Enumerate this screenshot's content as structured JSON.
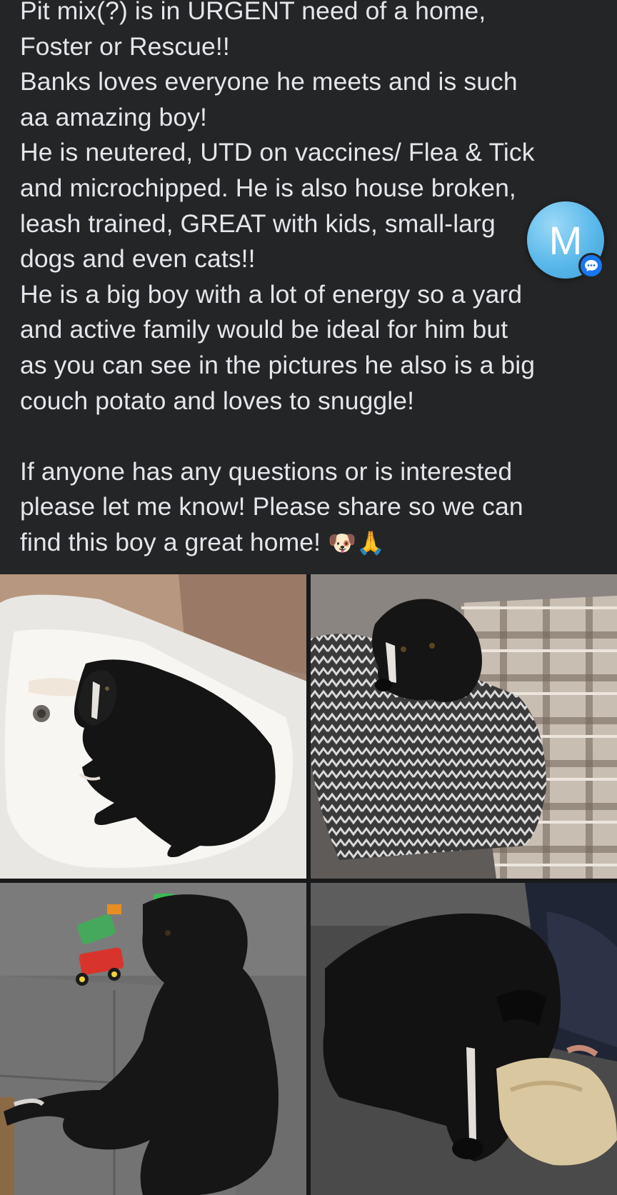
{
  "post": {
    "lines": [
      "Pit mix(?) is in URGENT need of a home,",
      "Foster or Rescue!!",
      "Banks loves everyone he meets and is such",
      "aa amazing boy!",
      "He is neutered, UTD on vaccines/ Flea & Tick",
      "and microchipped. He is also house broken,",
      "leash trained, GREAT with kids, small-larg",
      "dogs and even cats!!",
      "He is a big boy with a lot of energy so a yard",
      "and active family would be ideal for him but",
      "as you can see in the pictures he also is a big",
      "couch potato and loves to snuggle!",
      "",
      "If anyone has any questions or is interested",
      "please let me know! Please share so we can",
      "find this boy a great home!"
    ],
    "emoji_dog": "🐶",
    "emoji_pray": "🙏"
  },
  "chat_head": {
    "initial": "M",
    "icon": "messenger-chat-head",
    "color": "#5ab8ea",
    "badge_icon": "chat-bubble-icon",
    "badge_color": "#1877f2"
  },
  "photos": [
    {
      "icon": "dog-in-bathtub-photo"
    },
    {
      "icon": "dog-on-blanket-photo"
    },
    {
      "icon": "dog-on-couch-with-toys-photo"
    },
    {
      "icon": "dog-snuggling-child-photo"
    }
  ],
  "colors": {
    "background": "#242526",
    "text": "#e4e6eb"
  }
}
